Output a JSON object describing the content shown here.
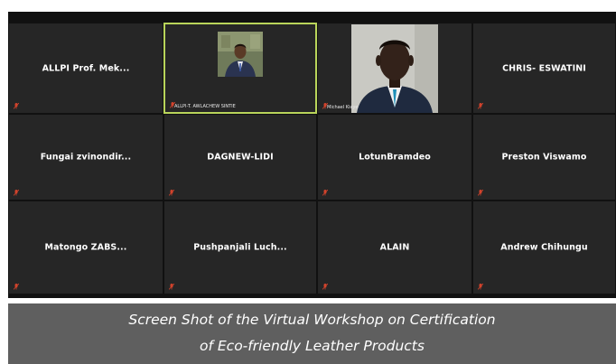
{
  "participants": [
    {
      "name": "ALLPI Prof. Mek...",
      "caption": "",
      "video": false,
      "active": false
    },
    {
      "name": "",
      "caption": "ALLPI-T. AWLACHEW SINTIE",
      "video": true,
      "active": true
    },
    {
      "name": "",
      "caption": "Michael Kiaye",
      "video": true,
      "active": false
    },
    {
      "name": "CHRIS- ESWATINI",
      "caption": "",
      "video": false,
      "active": false
    },
    {
      "name": "Fungai  zvinondir...",
      "caption": "",
      "video": false,
      "active": false
    },
    {
      "name": "DAGNEW-LIDI",
      "caption": "",
      "video": false,
      "active": false
    },
    {
      "name": "LotunBramdeo",
      "caption": "",
      "video": false,
      "active": false
    },
    {
      "name": "Preston Viswamo",
      "caption": "",
      "video": false,
      "active": false
    },
    {
      "name": "Matongo  ZABS...",
      "caption": "",
      "video": false,
      "active": false
    },
    {
      "name": "Pushpanjali  Luch...",
      "caption": "",
      "video": false,
      "active": false
    },
    {
      "name": "ALAIN",
      "caption": "",
      "video": false,
      "active": false
    },
    {
      "name": "Andrew Chihungu",
      "caption": "",
      "video": false,
      "active": false
    }
  ],
  "banner": {
    "line1": "Screen Shot of the Virtual Workshop on Certification",
    "line2": "of Eco-friendly Leather Products"
  },
  "colors": {
    "tile_bg": "#262626",
    "active_border": "#b9d45a",
    "muted_mic": "#d2432c",
    "banner_bg": "#5f5f5f"
  },
  "icons": {
    "mic": "muted-mic-icon"
  }
}
